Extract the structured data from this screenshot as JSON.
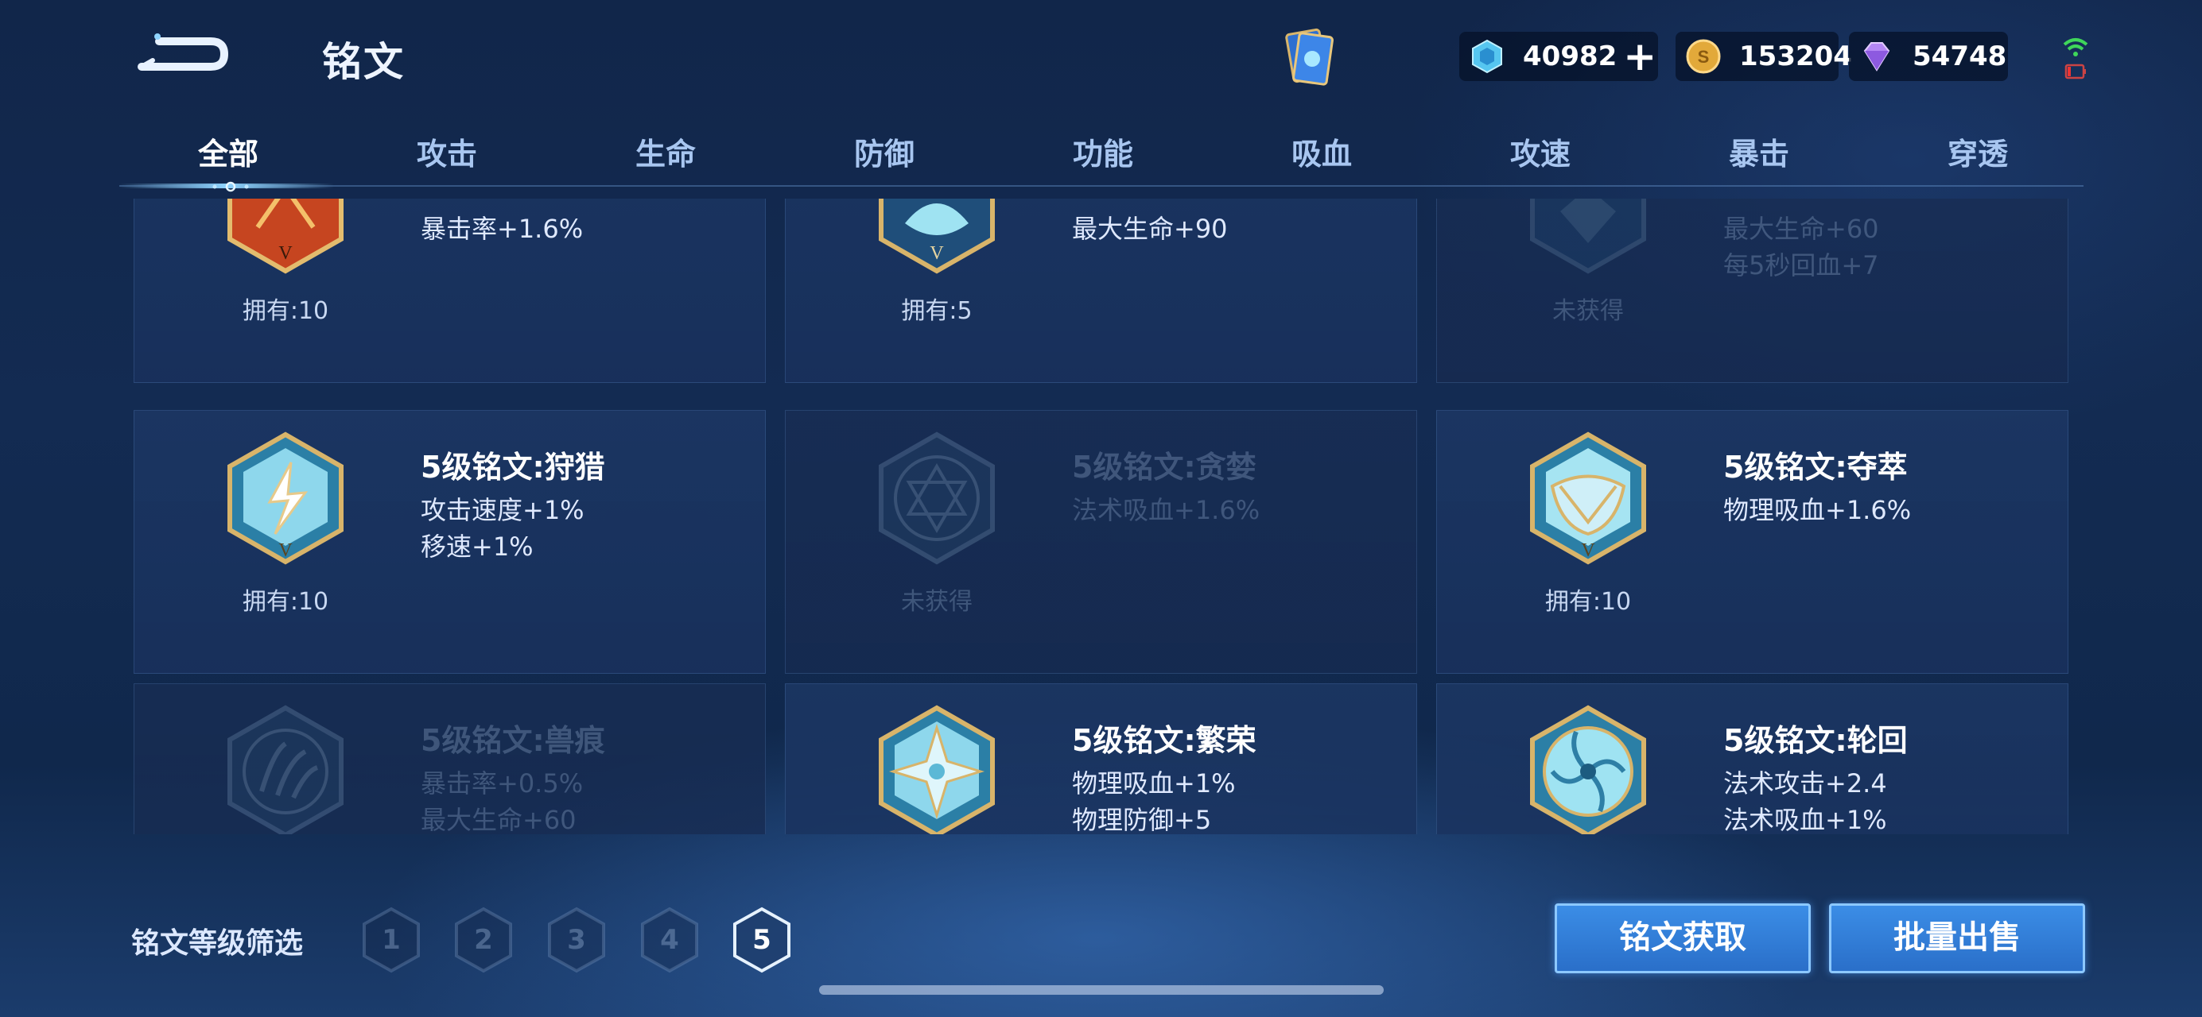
{
  "header": {
    "title": "铭文",
    "currencies": [
      {
        "name": "gem",
        "value": "40982"
      },
      {
        "name": "gold",
        "value": "153204"
      },
      {
        "name": "diamond",
        "value": "54748"
      }
    ],
    "plus_label": "+"
  },
  "tabs": [
    "全部",
    "攻击",
    "生命",
    "防御",
    "功能",
    "吸血",
    "攻速",
    "暴击",
    "穿透"
  ],
  "runes": [
    {
      "name": "",
      "stats": [
        "暴击率+1.6%"
      ],
      "owned": "拥有:10",
      "icon": "red-crit-rune",
      "locked": false
    },
    {
      "name": "",
      "stats": [
        "最大生命+90"
      ],
      "owned": "拥有:5",
      "icon": "blue-life-rune",
      "locked": false
    },
    {
      "name": "",
      "stats": [
        "最大生命+60",
        "每5秒回血+7"
      ],
      "owned": "未获得",
      "icon": "blue-regen-rune",
      "locked": true
    },
    {
      "name": "5级铭文:狩猎",
      "stats": [
        "攻击速度+1%",
        "移速+1%"
      ],
      "owned": "拥有:10",
      "icon": "lightning-rune",
      "locked": false
    },
    {
      "name": "5级铭文:贪婪",
      "stats": [
        "法术吸血+1.6%"
      ],
      "owned": "未获得",
      "icon": "hexagram-rune",
      "locked": true
    },
    {
      "name": "5级铭文:夺萃",
      "stats": [
        "物理吸血+1.6%"
      ],
      "owned": "拥有:10",
      "icon": "shield-rune",
      "locked": false
    },
    {
      "name": "5级铭文:兽痕",
      "stats": [
        "暴击率+0.5%",
        "最大生命+60"
      ],
      "owned": "",
      "icon": "claw-rune",
      "locked": true
    },
    {
      "name": "5级铭文:繁荣",
      "stats": [
        "物理吸血+1%",
        "物理防御+5"
      ],
      "owned": "",
      "icon": "star-rune",
      "locked": false
    },
    {
      "name": "5级铭文:轮回",
      "stats": [
        "法术攻击+2.4",
        "法术吸血+1%"
      ],
      "owned": "",
      "icon": "swirl-rune",
      "locked": false
    }
  ],
  "filter": {
    "label": "铭文等级筛选",
    "levels": [
      "1",
      "2",
      "3",
      "4",
      "5"
    ],
    "selected": "5"
  },
  "actions": {
    "obtain": "铭文获取",
    "bulk_sell": "批量出售"
  },
  "colors": {
    "accent_blue": "#3b8de6",
    "rune_gold": "#d8b46a",
    "rune_cyan": "#9fe3f2"
  }
}
